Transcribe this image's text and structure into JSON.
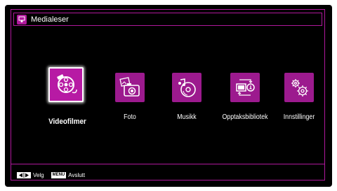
{
  "window": {
    "title": "Medialeser",
    "title_icon": "media-player-icon",
    "accent_color": "#b0189c"
  },
  "menu": {
    "selected_index": 0,
    "items": [
      {
        "label": "Videofilmer",
        "icon": "film-reel-icon"
      },
      {
        "label": "Foto",
        "icon": "camera-photo-icon"
      },
      {
        "label": "Musikk",
        "icon": "music-disc-icon"
      },
      {
        "label": "Opptaksbibliotek",
        "icon": "recording-library-icon"
      },
      {
        "label": "Innstillinger",
        "icon": "settings-gears-icon"
      }
    ]
  },
  "footer": {
    "nav_key_label": "◀|▶",
    "nav_text": "Velg",
    "menu_key_label": "MENU",
    "menu_text": "Avslutt"
  }
}
